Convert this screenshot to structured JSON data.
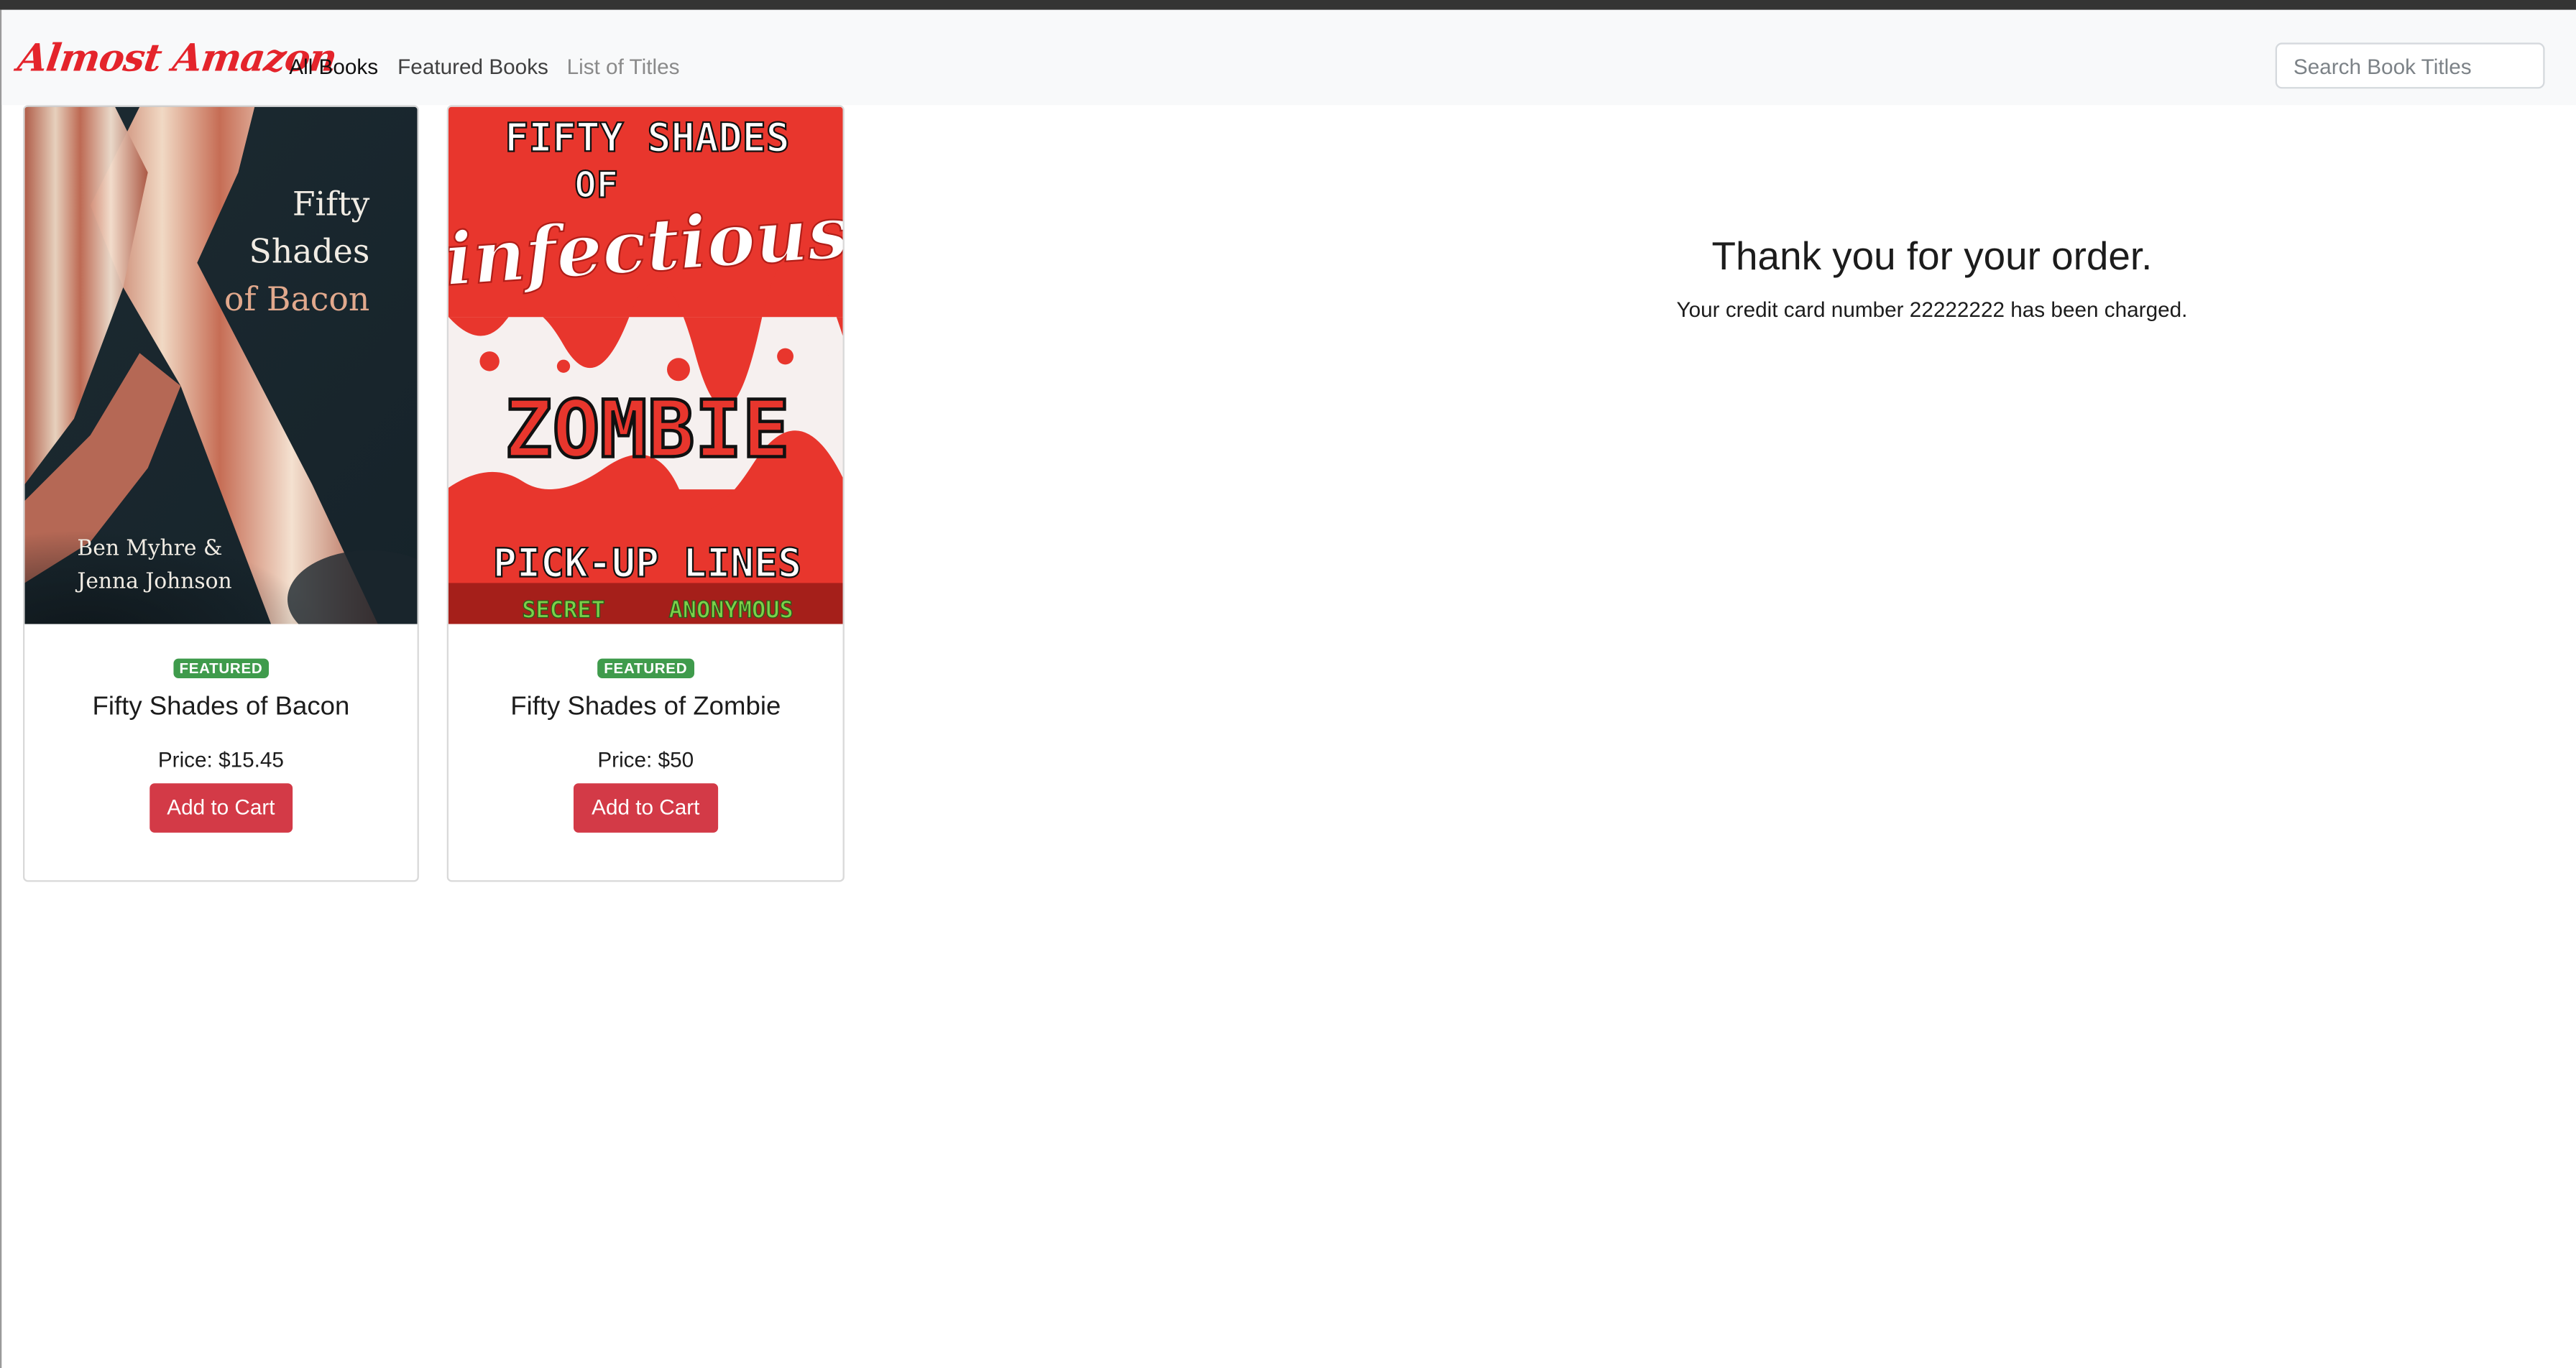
{
  "navbar": {
    "brand": "Almost Amazon",
    "links": [
      "All Books",
      "Featured Books",
      "List of Titles"
    ],
    "search_placeholder": "Search Book Titles"
  },
  "books": [
    {
      "badge": "FEATURED",
      "title": "Fifty Shades of Bacon",
      "price": "Price: $15.45",
      "button": "Add to Cart",
      "cover": {
        "title_lines": [
          "Fifty",
          "Shades",
          "of Bacon"
        ],
        "author_lines": [
          "Ben Myhre &",
          "Jenna Johnson"
        ]
      }
    },
    {
      "badge": "FEATURED",
      "title": "Fifty Shades of Zombie",
      "price": "Price: $50",
      "button": "Add to Cart",
      "cover": {
        "top_lines": [
          "FIFTY SHADES",
          "OF"
        ],
        "script": "infectious",
        "big": "ZOMBIE",
        "bottom": "PICK-UP LINES",
        "footer": [
          "SECRET",
          "ANONYMOUS"
        ]
      }
    }
  ],
  "confirmation": {
    "heading": "Thank you for your order.",
    "message": "Your credit card number 22222222 has been charged."
  },
  "colors": {
    "brand": "#e4242b",
    "badge": "#3f9b4c",
    "button": "#d33a47",
    "navbar_bg": "#f8f9fa"
  }
}
